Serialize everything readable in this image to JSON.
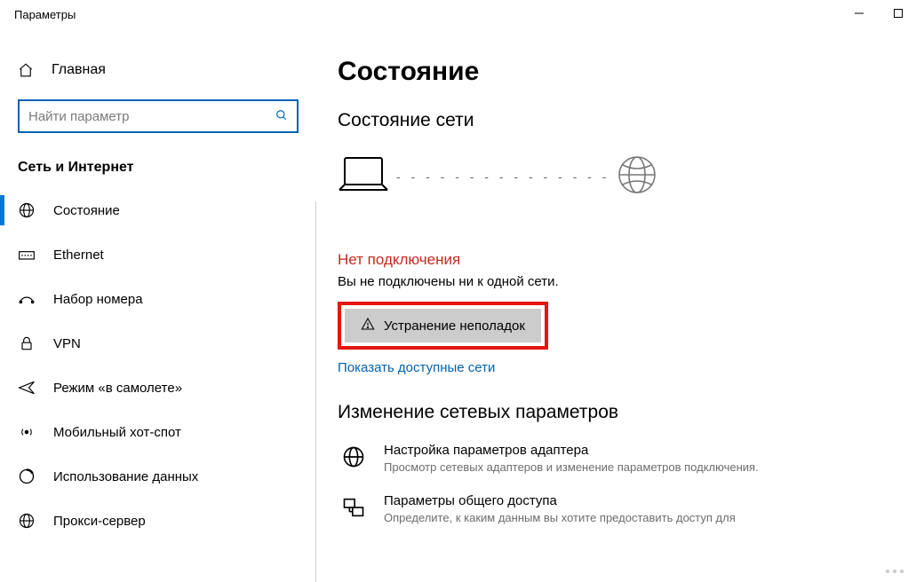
{
  "window": {
    "title": "Параметры"
  },
  "sidebar": {
    "home": "Главная",
    "search_placeholder": "Найти параметр",
    "section": "Сеть и Интернет",
    "items": [
      {
        "label": "Состояние",
        "active": true
      },
      {
        "label": "Ethernet"
      },
      {
        "label": "Набор номера"
      },
      {
        "label": "VPN"
      },
      {
        "label": "Режим «в самолете»"
      },
      {
        "label": "Мобильный хот-спот"
      },
      {
        "label": "Использование данных"
      },
      {
        "label": "Прокси-сервер"
      }
    ]
  },
  "content": {
    "title": "Состояние",
    "subtitle": "Состояние сети",
    "status_title": "Нет подключения",
    "status_desc": "Вы не подключены ни к одной сети.",
    "troubleshoot_label": "Устранение неполадок",
    "show_networks_link": "Показать доступные сети",
    "change_settings_title": "Изменение сетевых параметров",
    "options": [
      {
        "title": "Настройка параметров адаптера",
        "desc": "Просмотр сетевых адаптеров и изменение параметров подключения."
      },
      {
        "title": "Параметры общего доступа",
        "desc": "Определите, к каким данным вы хотите предоставить доступ для"
      }
    ]
  }
}
